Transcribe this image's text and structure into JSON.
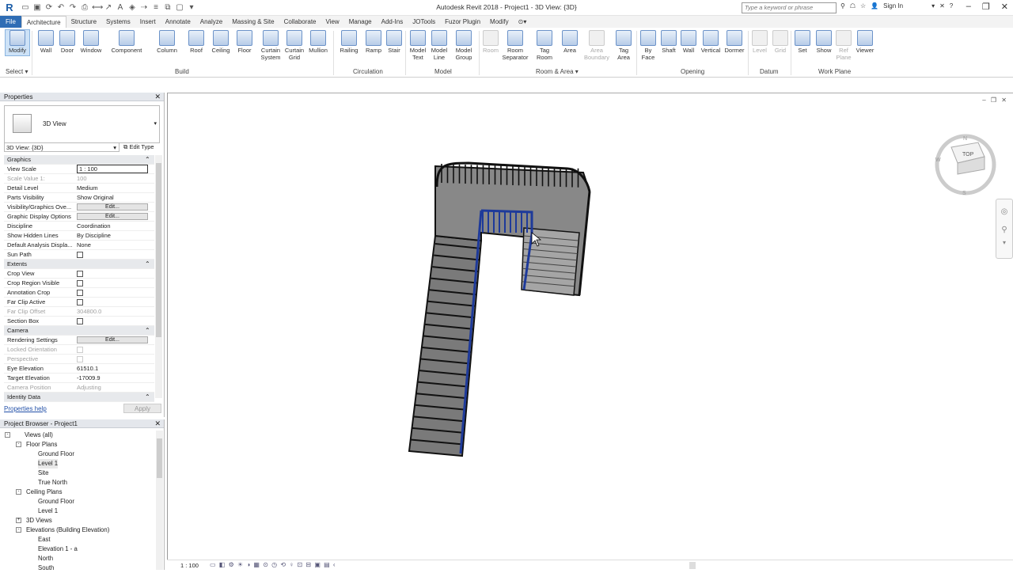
{
  "app": {
    "title": "Autodesk Revit 2018 -    Project1 - 3D View: {3D}",
    "search_placeholder": "Type a keyword or phrase",
    "sign_in": "Sign In"
  },
  "tabs": [
    "File",
    "Architecture",
    "Structure",
    "Systems",
    "Insert",
    "Annotate",
    "Analyze",
    "Massing & Site",
    "Collaborate",
    "View",
    "Manage",
    "Add-Ins",
    "JOTools",
    "Fuzor Plugin",
    "Modify"
  ],
  "ribbon": {
    "modify": "Modify",
    "select": "Select",
    "build": {
      "label": "Build",
      "buttons": [
        "Wall",
        "Door",
        "Window",
        "Component",
        "Column",
        "Roof",
        "Ceiling",
        "Floor",
        "Curtain System",
        "Curtain Grid",
        "Mullion"
      ]
    },
    "circulation": {
      "label": "Circulation",
      "buttons": [
        "Railing",
        "Ramp",
        "Stair"
      ]
    },
    "model": {
      "label": "Model",
      "buttons": [
        "Model Text",
        "Model Line",
        "Model Group"
      ]
    },
    "room_area": {
      "label": "Room & Area",
      "buttons": [
        "Room",
        "Room Separator",
        "Tag Room",
        "Area",
        "Area Boundary",
        "Tag Area"
      ]
    },
    "opening": {
      "label": "Opening",
      "buttons": [
        "By Face",
        "Shaft",
        "Wall",
        "Vertical",
        "Dormer"
      ]
    },
    "datum": {
      "label": "Datum",
      "buttons": [
        "Level",
        "Grid"
      ]
    },
    "work_plane": {
      "label": "Work Plane",
      "buttons": [
        "Set",
        "Show",
        "Ref Plane",
        "Viewer"
      ]
    }
  },
  "properties": {
    "title": "Properties",
    "type_name": "3D View",
    "view_selector": "3D View: {3D}",
    "edit_type": "Edit Type",
    "rows": [
      {
        "kind": "section",
        "name": "Graphics"
      },
      {
        "name": "View Scale",
        "value": "1 : 100",
        "kind": "input"
      },
      {
        "name": "Scale Value    1:",
        "value": "100",
        "kind": "grey"
      },
      {
        "name": "Detail Level",
        "value": "Medium"
      },
      {
        "name": "Parts Visibility",
        "value": "Show Original"
      },
      {
        "name": "Visibility/Graphics Ove...",
        "value": "Edit...",
        "kind": "button"
      },
      {
        "name": "Graphic Display Options",
        "value": "Edit...",
        "kind": "button"
      },
      {
        "name": "Discipline",
        "value": "Coordination"
      },
      {
        "name": "Show Hidden Lines",
        "value": "By Discipline"
      },
      {
        "name": "Default Analysis Displa...",
        "value": "None"
      },
      {
        "name": "Sun Path",
        "value": "",
        "kind": "check"
      },
      {
        "kind": "section",
        "name": "Extents"
      },
      {
        "name": "Crop View",
        "value": "",
        "kind": "check"
      },
      {
        "name": "Crop Region Visible",
        "value": "",
        "kind": "check"
      },
      {
        "name": "Annotation Crop",
        "value": "",
        "kind": "check"
      },
      {
        "name": "Far Clip Active",
        "value": "",
        "kind": "check"
      },
      {
        "name": "Far Clip Offset",
        "value": "304800.0",
        "kind": "grey"
      },
      {
        "name": "Section Box",
        "value": "",
        "kind": "check"
      },
      {
        "kind": "section",
        "name": "Camera"
      },
      {
        "name": "Rendering Settings",
        "value": "Edit...",
        "kind": "button"
      },
      {
        "name": "Locked Orientation",
        "value": "",
        "kind": "greycheck"
      },
      {
        "name": "Perspective",
        "value": "",
        "kind": "greycheck"
      },
      {
        "name": "Eye Elevation",
        "value": "61510.1"
      },
      {
        "name": "Target Elevation",
        "value": "-17009.9"
      },
      {
        "name": "Camera Position",
        "value": "Adjusting",
        "kind": "grey"
      },
      {
        "kind": "section",
        "name": "Identity Data"
      }
    ],
    "help_link": "Properties help",
    "apply": "Apply"
  },
  "browser": {
    "title": "Project Browser - Project1",
    "nodes": [
      {
        "label": "Views (all)",
        "level": 0,
        "toggle": "-"
      },
      {
        "label": "Floor Plans",
        "level": 1,
        "toggle": "-"
      },
      {
        "label": "Ground Floor",
        "level": 2
      },
      {
        "label": "Level 1",
        "level": 2,
        "selected": true
      },
      {
        "label": "Site",
        "level": 2
      },
      {
        "label": "True North",
        "level": 2
      },
      {
        "label": "Ceiling Plans",
        "level": 1,
        "toggle": "-"
      },
      {
        "label": "Ground Floor",
        "level": 2
      },
      {
        "label": "Level 1",
        "level": 2
      },
      {
        "label": "3D Views",
        "level": 1,
        "toggle": "+"
      },
      {
        "label": "Elevations (Building Elevation)",
        "level": 1,
        "toggle": "-"
      },
      {
        "label": "East",
        "level": 2
      },
      {
        "label": "Elevation 1 - a",
        "level": 2
      },
      {
        "label": "North",
        "level": 2
      },
      {
        "label": "South",
        "level": 2
      }
    ]
  },
  "view": {
    "scale": "1 : 100",
    "viewcube_face": "TOP"
  },
  "colors": {
    "accent": "#2f6db5",
    "railing": "#1e3a9a"
  }
}
